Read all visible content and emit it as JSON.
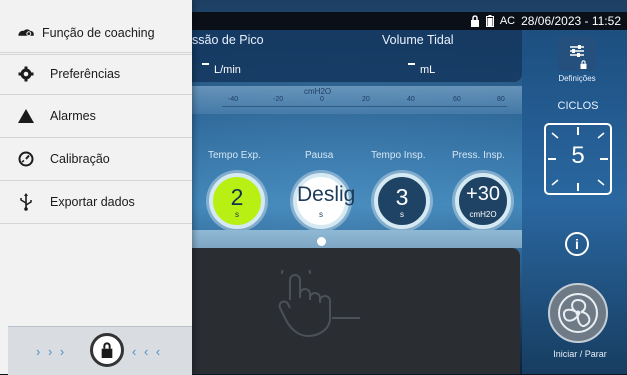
{
  "status": {
    "ac_label": "AC",
    "datetime": "28/06/2023 - 11:52"
  },
  "header": {
    "pressure_title": "ssão de Pico",
    "pressure_unit": "L/min",
    "volume_title": "Volume Tidal",
    "volume_unit": "mL"
  },
  "scale": {
    "unit": "cmH2O",
    "ticks": [
      "-40",
      "-20",
      "0",
      "20",
      "40",
      "60",
      "80"
    ]
  },
  "params": [
    {
      "label": "Tempo Exp.",
      "value": "2",
      "unit": "s"
    },
    {
      "label": "Pausa",
      "value": "Deslig",
      "unit": "s"
    },
    {
      "label": "Tempo Insp.",
      "value": "3",
      "unit": "s"
    },
    {
      "label": "Press. Insp.",
      "value": "+30",
      "unit": "cmH2O"
    }
  ],
  "right": {
    "settings_label": "Definições",
    "cycles_label": "CICLOS",
    "cycles_value": "5",
    "start_label": "Iniciar / Parar"
  },
  "drawer": {
    "items": [
      {
        "label": "Função de coaching",
        "icon": "coaching-icon"
      },
      {
        "label": "Preferências",
        "icon": "gear-icon"
      },
      {
        "label": "Alarmes",
        "icon": "warning-triangle-icon"
      },
      {
        "label": "Calibração",
        "icon": "gauge-icon"
      },
      {
        "label": "Exportar dados",
        "icon": "usb-icon"
      }
    ],
    "lock_arrows_left": "› › ›",
    "lock_arrows_right": "‹ ‹ ‹"
  },
  "colors": {
    "accent_green": "#b8f014",
    "accent_blue": "#4a91c7"
  }
}
